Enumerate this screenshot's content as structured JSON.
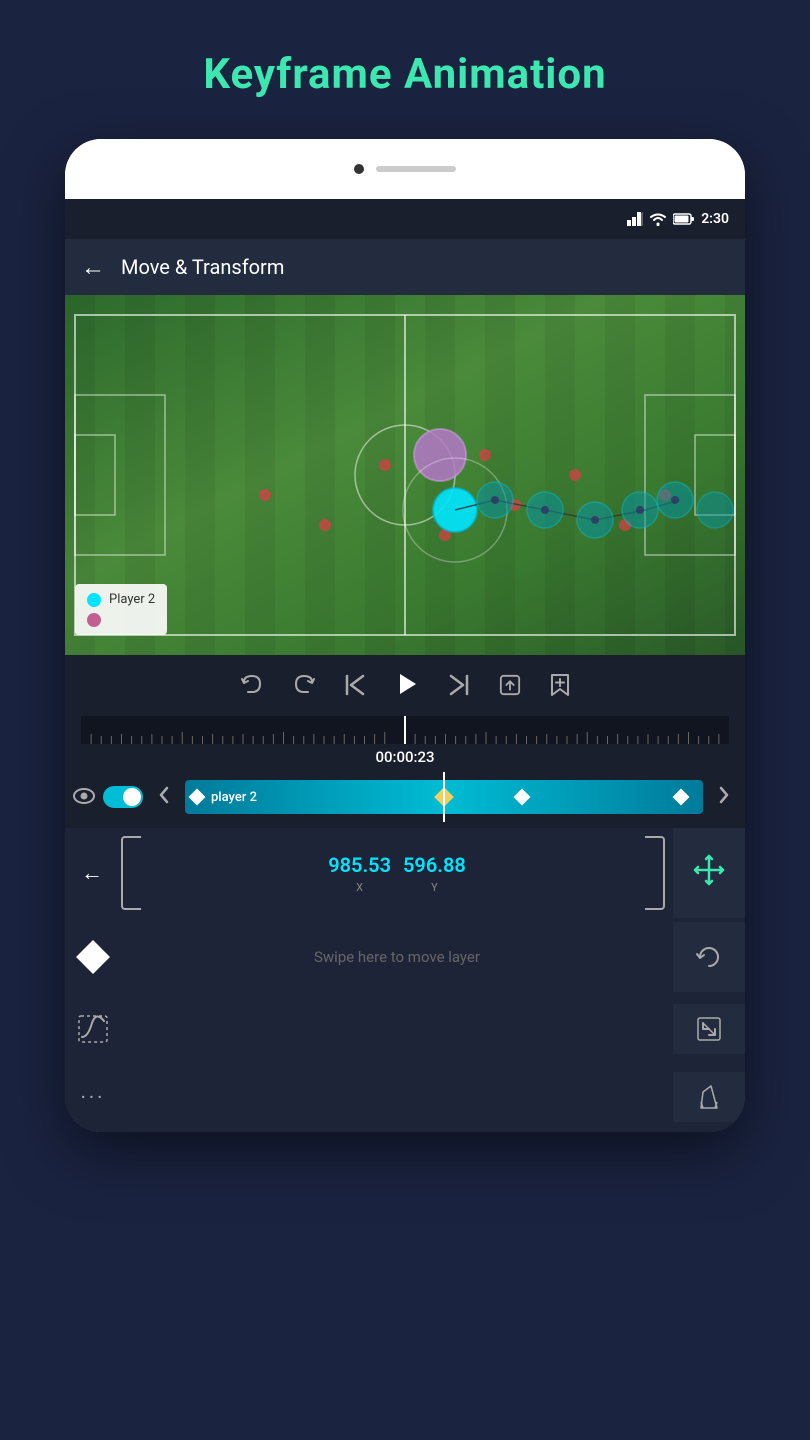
{
  "page": {
    "title": "Keyframe Animation"
  },
  "status_bar": {
    "time": "2:30"
  },
  "app_bar": {
    "title": "Move & Transform",
    "back_label": "←"
  },
  "legend": {
    "player2_label": "Player 2"
  },
  "controls": {
    "timecode": "00:00:23",
    "undo_label": "↺",
    "redo_label": "↻",
    "skip_start_label": "|◀",
    "play_label": "▶",
    "skip_end_label": "▶|",
    "loop_label": "⊡",
    "bookmark_label": "🔖"
  },
  "track": {
    "label": "player 2"
  },
  "transform": {
    "back_label": "←",
    "x_value": "985.53",
    "x_label": "X",
    "y_value": "596.88",
    "y_label": "Y",
    "swipe_text": "Swipe here to move layer"
  }
}
